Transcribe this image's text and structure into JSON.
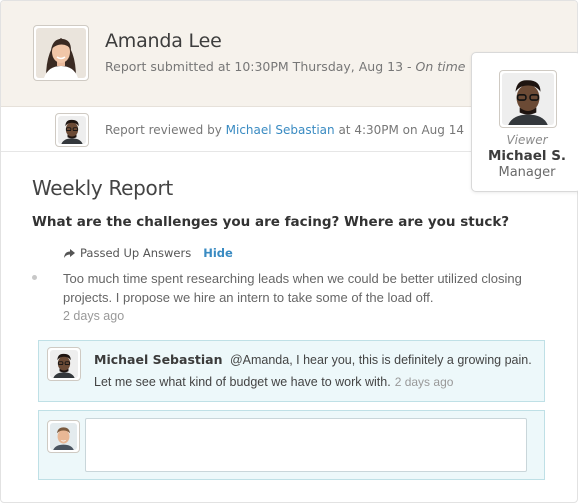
{
  "header": {
    "name": "Amanda Lee",
    "submitted_text": "Report submitted at 10:30PM Thursday, Aug 13 - ",
    "status": "On time"
  },
  "review": {
    "prefix": "Report reviewed by ",
    "reviewer": "Michael Sebastian",
    "suffix": " at 4:30PM on Aug 14"
  },
  "viewer": {
    "label": "Viewer",
    "name": "Michael S.",
    "role": "Manager"
  },
  "report": {
    "title": "Weekly Report",
    "question": "What are the challenges you are facing? Where are you stuck?",
    "passed_up_label": "Passed Up Answers",
    "hide_label": "Hide",
    "answer": "Too much time spent researching leads when we could be better utilized closing projects. I propose we hire an intern to take some of the load off.",
    "answer_time": "2 days ago"
  },
  "comment": {
    "author": "Michael Sebastian",
    "text": "@Amanda, I hear you, this is definitely a growing pain. Let me see what kind of budget we have to work with.",
    "time": "2 days ago"
  },
  "reply": {
    "value": "",
    "placeholder": ""
  },
  "colors": {
    "header_bg": "#f6f2ec",
    "link": "#3a8bc2",
    "comment_bg": "#edf8fa",
    "comment_border": "#bfe0e6"
  }
}
